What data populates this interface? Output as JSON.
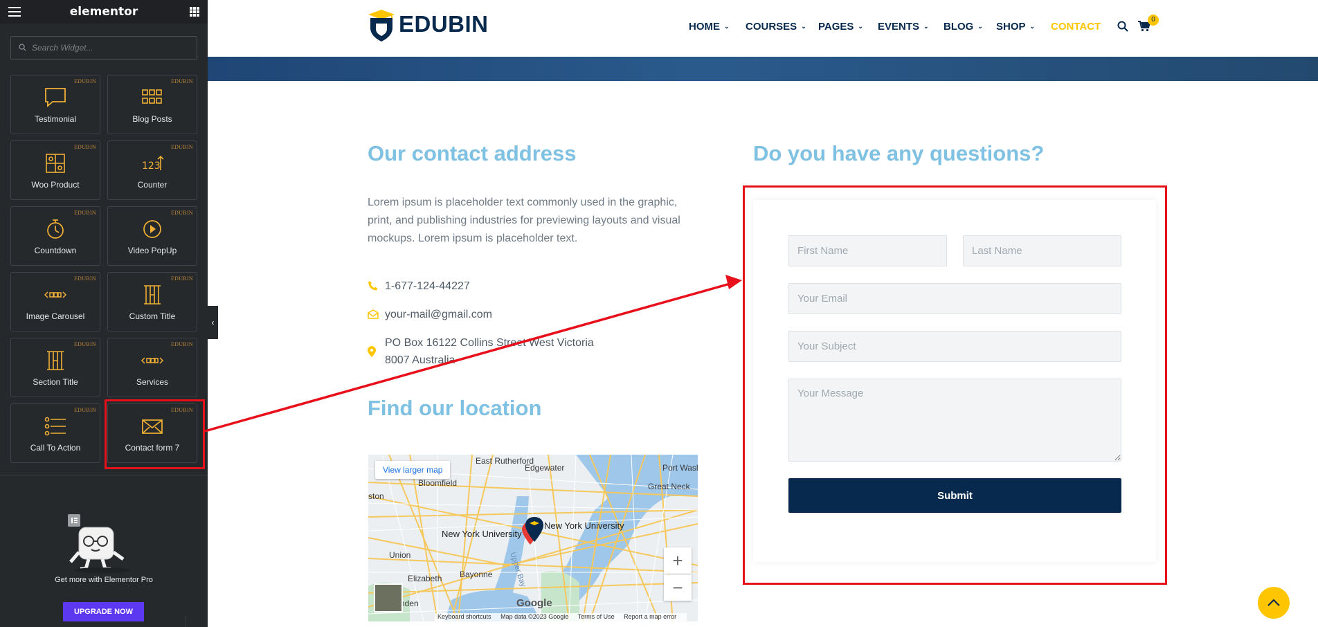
{
  "sidebar": {
    "title": "elementor",
    "search_placeholder": "Search Widget...",
    "widgets": [
      {
        "label": "Testimonial",
        "badge": "EDUBIN",
        "icon": "testimonial-icon"
      },
      {
        "label": "Blog Posts",
        "badge": "EDUBIN",
        "icon": "blog-posts-icon"
      },
      {
        "label": "Woo Product",
        "badge": "EDUBIN",
        "icon": "woo-product-icon"
      },
      {
        "label": "Counter",
        "badge": "EDUBIN",
        "icon": "counter-icon"
      },
      {
        "label": "Countdown",
        "badge": "EDUBIN",
        "icon": "countdown-icon"
      },
      {
        "label": "Video PopUp",
        "badge": "EDUBIN",
        "icon": "video-popup-icon"
      },
      {
        "label": "Image Carousel",
        "badge": "EDUBIN",
        "icon": "image-carousel-icon"
      },
      {
        "label": "Custom Title",
        "badge": "EDUBIN",
        "icon": "custom-title-icon"
      },
      {
        "label": "Section Title",
        "badge": "EDUBIN",
        "icon": "section-title-icon"
      },
      {
        "label": "Services",
        "badge": "EDUBIN",
        "icon": "services-icon"
      },
      {
        "label": "Call To Action",
        "badge": "EDUBIN",
        "icon": "call-to-action-icon"
      },
      {
        "label": "Contact form 7",
        "badge": "EDUBIN",
        "icon": "contact-form-icon"
      }
    ],
    "promo_text": "Get more with Elementor Pro",
    "upgrade_label": "UPGRADE NOW"
  },
  "header": {
    "logo_text": "EDUBIN",
    "nav": [
      {
        "label": "HOME",
        "has_dropdown": true
      },
      {
        "label": "COURSES",
        "has_dropdown": true
      },
      {
        "label": "PAGES",
        "has_dropdown": true
      },
      {
        "label": "EVENTS",
        "has_dropdown": true
      },
      {
        "label": "BLOG",
        "has_dropdown": true
      },
      {
        "label": "SHOP",
        "has_dropdown": true
      },
      {
        "label": "CONTACT",
        "has_dropdown": false,
        "active": true
      }
    ],
    "cart_count": "0"
  },
  "contact": {
    "heading": "Our contact address",
    "text": "Lorem ipsum is placeholder text commonly used in the graphic, print, and publishing industries for previewing layouts and visual mockups. Lorem ipsum is placeholder text.",
    "phone": "1-677-124-44227",
    "email": "your-mail@gmail.com",
    "address_line1": "PO Box 16122 Collins Street West Victoria",
    "address_line2": "8007 Australia"
  },
  "location": {
    "heading": "Find our location",
    "view_larger": "View larger map",
    "zoom_in": "+",
    "zoom_out": "−",
    "google": "Google",
    "footer": [
      "Keyboard shortcuts",
      "Map data ©2023 Google",
      "Terms of Use",
      "Report a map error"
    ],
    "labels": [
      "East Rutherford",
      "Edgewater",
      "Port Washington",
      "Bloomfield",
      "Great Neck",
      "ston",
      "New York University",
      "New York University",
      "Union",
      "Elizabeth",
      "Bayonne",
      "Upper Bay",
      "nden"
    ]
  },
  "form": {
    "heading": "Do you have any questions?",
    "first_name": "First Name",
    "last_name": "Last Name",
    "email": "Your Email",
    "subject": "Your Subject",
    "message": "Your Message",
    "submit": "Submit"
  },
  "colors": {
    "brand_navy": "#07294d",
    "accent_yellow": "#ffc600",
    "heading_blue": "#7ec1e2",
    "annotation_red": "#e8101b",
    "elementor_dark": "#26292c"
  }
}
